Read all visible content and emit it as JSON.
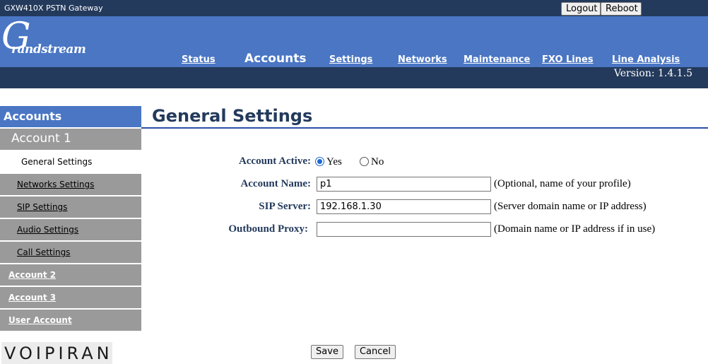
{
  "header": {
    "app_title": "GXW410X PSTN Gateway",
    "logout_label": "Logout",
    "reboot_label": "Reboot",
    "logo_mark": "G",
    "logo_text": "randstream",
    "version": "Version: 1.4.1.5"
  },
  "nav": {
    "status": "Status",
    "accounts": "Accounts",
    "settings": "Settings",
    "networks": "Networks",
    "maintenance": "Maintenance",
    "fxo_lines": "FXO Lines",
    "line_analysis": "Line Analysis",
    "active": "Accounts"
  },
  "sidebar": {
    "section": "Accounts",
    "account1": "Account 1",
    "items": [
      "General Settings",
      "Networks Settings",
      "SIP Settings",
      "Audio Settings",
      "Call Settings"
    ],
    "account2": "Account 2",
    "account3": "Account 3",
    "user_account": "User Account",
    "brand": "VOIPIRAN"
  },
  "main": {
    "title": "General Settings",
    "account_active": {
      "label": "Account Active:",
      "yes": "Yes",
      "no": "No",
      "selected": "Yes"
    },
    "account_name": {
      "label": "Account Name:",
      "value": "p1",
      "hint": "(Optional, name of your profile)"
    },
    "sip_server": {
      "label": "SIP Server:",
      "value": "192.168.1.30",
      "hint": "(Server domain name or IP address)"
    },
    "outbound_proxy": {
      "label": "Outbound Proxy:",
      "value": "",
      "hint": "(Domain name or IP address if in use)"
    },
    "save_label": "Save",
    "cancel_label": "Cancel"
  },
  "colors": {
    "top_bar": "#233a5c",
    "nav_bar": "#4a76c4",
    "sidebar_gray": "#9a9a9a",
    "title_color": "#233a5c",
    "title_rule": "#2c4ea8"
  }
}
